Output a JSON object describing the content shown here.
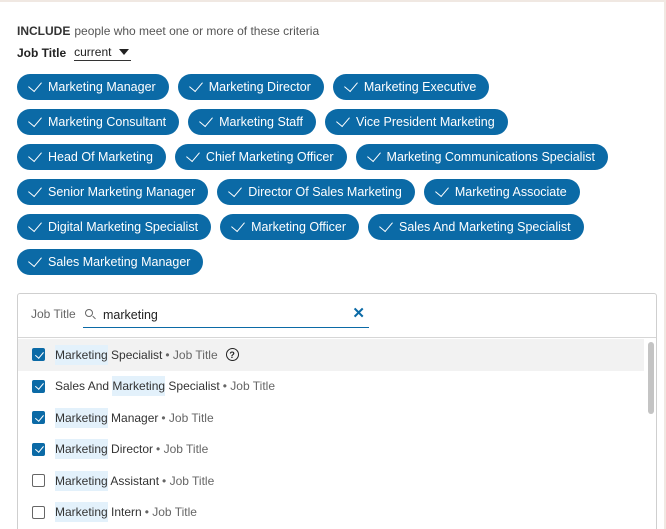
{
  "criteria": {
    "prefix": "INCLUDE",
    "text": "people who meet one or more of these criteria"
  },
  "job_title_filter": {
    "label": "Job Title",
    "selected": "current"
  },
  "chip_rows": [
    [
      "Marketing Manager",
      "Marketing Director",
      "Marketing Executive"
    ],
    [
      "Marketing Consultant",
      "Marketing Staff",
      "Vice President Marketing"
    ],
    [
      "Head Of Marketing",
      "Chief Marketing Officer",
      "Marketing Communications Specialist"
    ],
    [
      "Senior Marketing Manager",
      "Director Of Sales Marketing",
      "Marketing Associate"
    ],
    [
      "Digital Marketing Specialist",
      "Marketing Officer",
      "Sales And Marketing Specialist"
    ],
    [
      "Sales Marketing Manager"
    ]
  ],
  "search": {
    "label": "Job Title",
    "value": "marketing"
  },
  "results": [
    {
      "pre": "",
      "match": "Marketing",
      "post": " Specialist",
      "meta": "• Job Title",
      "checked": true,
      "help": true
    },
    {
      "pre": "Sales And ",
      "match": "Marketing",
      "post": " Specialist",
      "meta": "• Job Title",
      "checked": true,
      "help": false
    },
    {
      "pre": "",
      "match": "Marketing",
      "post": " Manager",
      "meta": "• Job Title",
      "checked": true,
      "help": false
    },
    {
      "pre": "",
      "match": "Marketing",
      "post": " Director",
      "meta": "• Job Title",
      "checked": true,
      "help": false
    },
    {
      "pre": "",
      "match": "Marketing",
      "post": " Assistant",
      "meta": "• Job Title",
      "checked": false,
      "help": false
    },
    {
      "pre": "",
      "match": "Marketing",
      "post": " Intern",
      "meta": "• Job Title",
      "checked": false,
      "help": false
    }
  ],
  "icons": {
    "check": "check-icon",
    "search": "search-icon",
    "clear": "close-icon",
    "help": "help-circle-icon",
    "caret": "caret-down-icon"
  },
  "colors": {
    "accent": "#0b6aa6",
    "highlight": "#e3f1fb"
  }
}
